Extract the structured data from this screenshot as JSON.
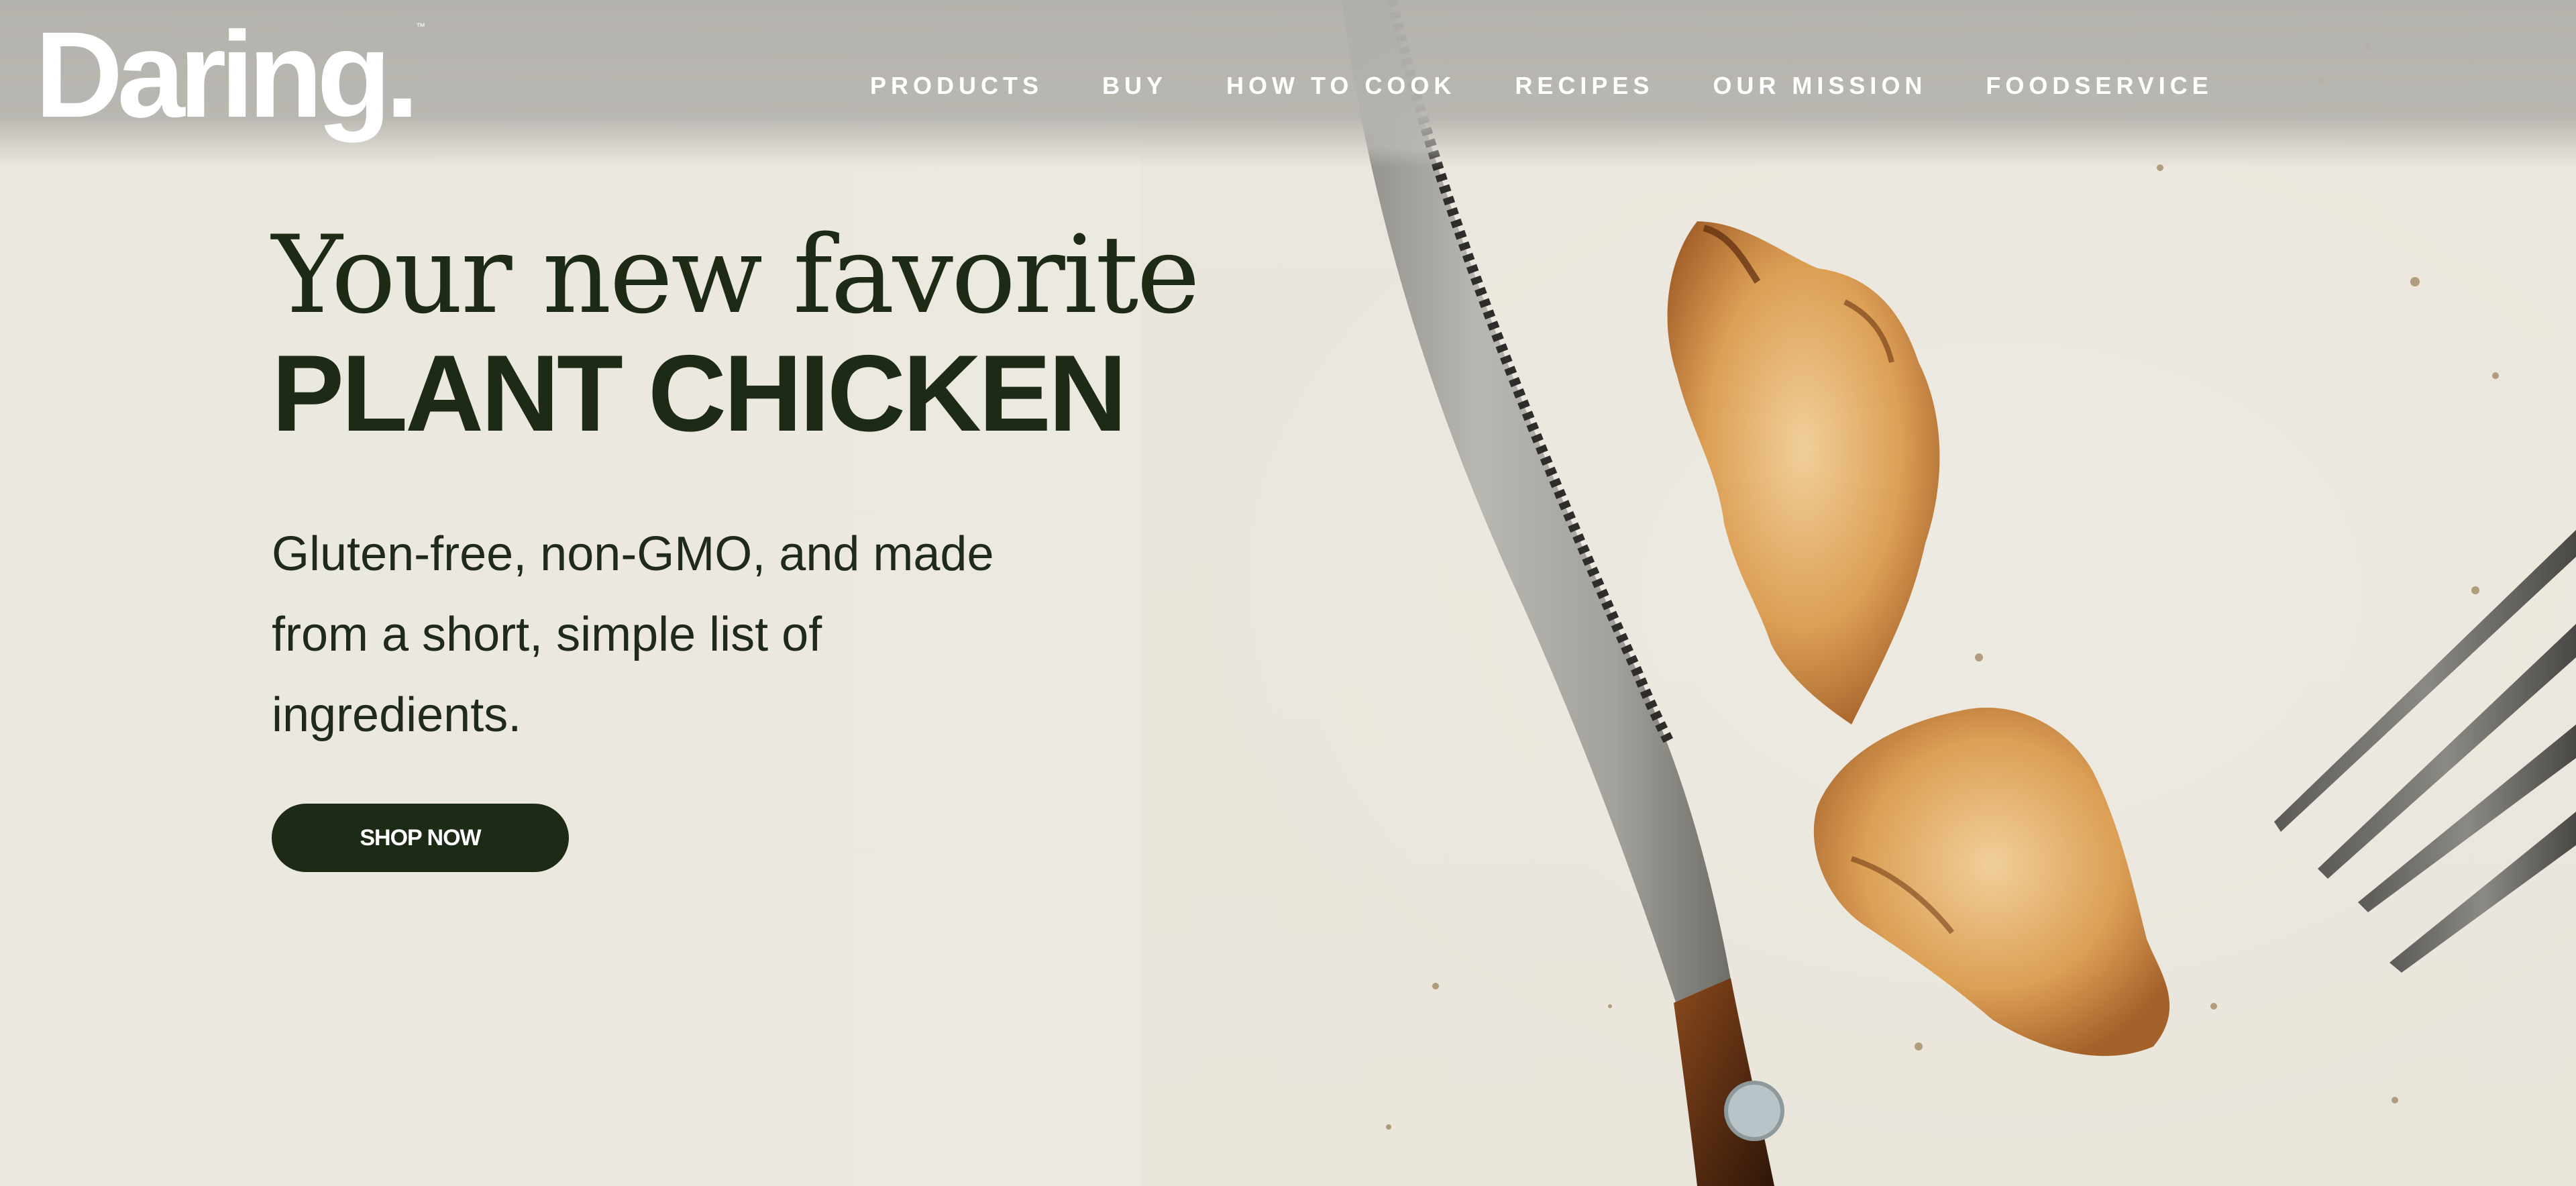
{
  "brand": {
    "logo_text": "Daring.",
    "trademark": "™"
  },
  "nav": {
    "items": [
      {
        "label": "PRODUCTS"
      },
      {
        "label": "BUY"
      },
      {
        "label": "HOW TO COOK"
      },
      {
        "label": "RECIPES"
      },
      {
        "label": "OUR MISSION"
      },
      {
        "label": "FOODSERVICE"
      }
    ]
  },
  "hero": {
    "headline_line1": "Your new favorite",
    "headline_line2": "PLANT CHICKEN",
    "subcopy": "Gluten-free, non-GMO, and made from a short, simple list of ingredients.",
    "cta_label": "SHOP NOW"
  },
  "colors": {
    "text_dark": "#1d2a16",
    "button_bg": "#1d2a16",
    "background": "#ece9e0",
    "header_bg": "#b4b2ac",
    "nav_text": "#ffffff"
  },
  "imagery": {
    "hero_photo": "knife-fork-plant-chicken-photo"
  }
}
